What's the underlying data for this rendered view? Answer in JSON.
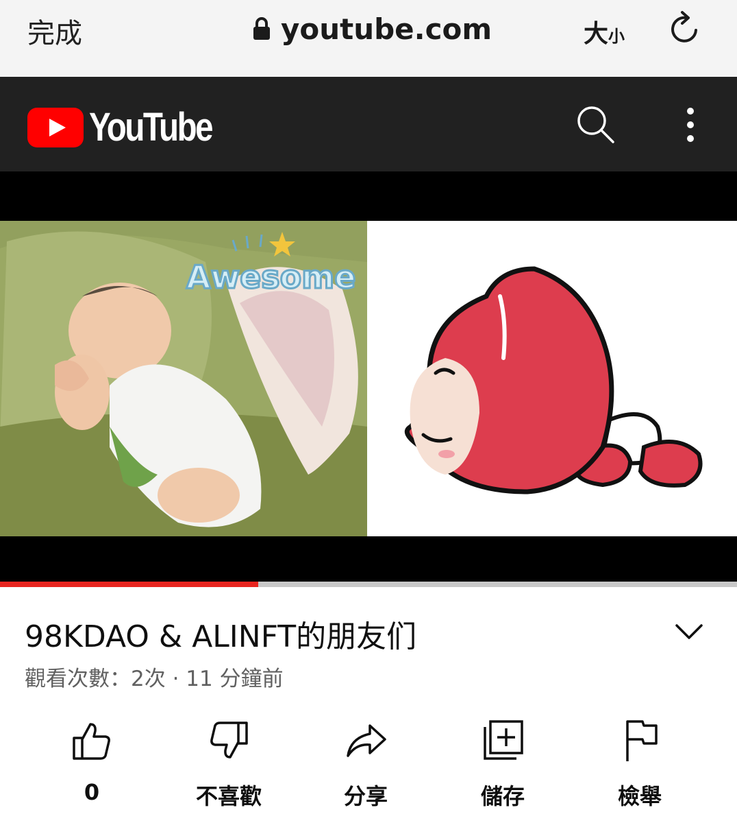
{
  "browser": {
    "done_label": "完成",
    "url": "youtube.com",
    "textsize_big": "大",
    "textsize_small": "小",
    "icons": [
      "lock-icon",
      "reload-icon"
    ]
  },
  "header": {
    "logo_text": "YouTube",
    "icons": [
      "youtube-logo-icon",
      "search-icon",
      "more-vertical-icon"
    ],
    "colors": {
      "background": "#212121",
      "brand_red": "#ff0000"
    }
  },
  "player": {
    "overlay_text": "Awesome",
    "progress": 0.35,
    "colors": {
      "progress_fill": "#e8251f",
      "progress_track": "#c8c8c8"
    }
  },
  "video": {
    "title": "98KDAO & ALINFT的朋友们",
    "meta": "觀看次數：2次 · 11 分鐘前"
  },
  "actions": [
    {
      "icon": "thumbs-up-icon",
      "label": "0"
    },
    {
      "icon": "thumbs-down-icon",
      "label": "不喜歡"
    },
    {
      "icon": "share-icon",
      "label": "分享"
    },
    {
      "icon": "save-playlist-icon",
      "label": "儲存"
    },
    {
      "icon": "flag-icon",
      "label": "檢舉"
    }
  ]
}
